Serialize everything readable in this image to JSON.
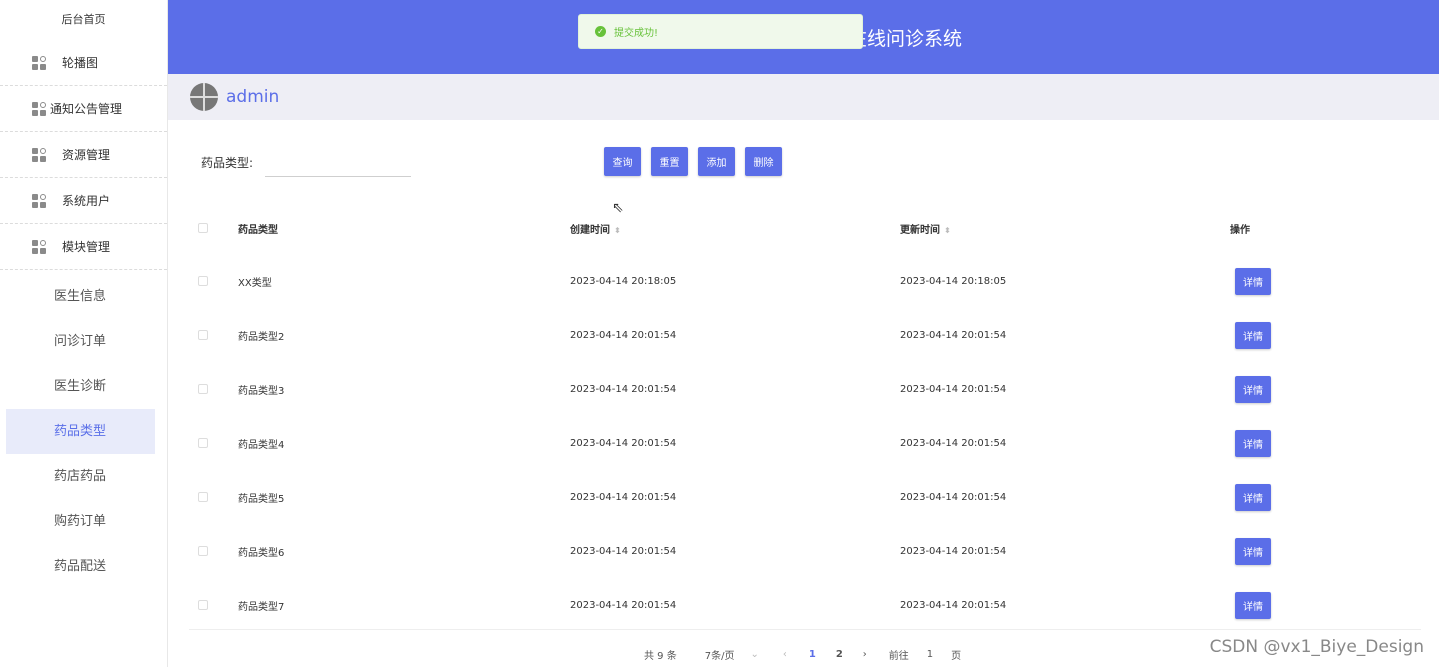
{
  "sidebar": {
    "home": "后台首页",
    "groups": [
      "轮播图",
      "通知公告管理",
      "资源管理",
      "系统用户",
      "模块管理"
    ],
    "subitems": [
      "医生信息",
      "问诊订单",
      "医生诊断",
      "药品类型",
      "药店药品",
      "购药订单",
      "药品配送"
    ],
    "active": "药品类型"
  },
  "header": {
    "title": "在线问诊系统"
  },
  "toast": {
    "message": "提交成功!"
  },
  "user": {
    "name": "admin"
  },
  "filter": {
    "label": "药品类型:",
    "value": ""
  },
  "buttons": {
    "search": "查询",
    "reset": "重置",
    "add": "添加",
    "delete": "删除"
  },
  "table": {
    "headers": [
      "药品类型",
      "创建时间",
      "更新时间",
      "操作"
    ],
    "rows": [
      {
        "name": "XX类型",
        "created": "2023-04-14 20:18:05",
        "updated": "2023-04-14 20:18:05",
        "op": "详情"
      },
      {
        "name": "药品类型2",
        "created": "2023-04-14 20:01:54",
        "updated": "2023-04-14 20:01:54",
        "op": "详情"
      },
      {
        "name": "药品类型3",
        "created": "2023-04-14 20:01:54",
        "updated": "2023-04-14 20:01:54",
        "op": "详情"
      },
      {
        "name": "药品类型4",
        "created": "2023-04-14 20:01:54",
        "updated": "2023-04-14 20:01:54",
        "op": "详情"
      },
      {
        "name": "药品类型5",
        "created": "2023-04-14 20:01:54",
        "updated": "2023-04-14 20:01:54",
        "op": "详情"
      },
      {
        "name": "药品类型6",
        "created": "2023-04-14 20:01:54",
        "updated": "2023-04-14 20:01:54",
        "op": "详情"
      },
      {
        "name": "药品类型7",
        "created": "2023-04-14 20:01:54",
        "updated": "2023-04-14 20:01:54",
        "op": "详情"
      }
    ]
  },
  "pagination": {
    "total": "共 9 条",
    "page_size": "7条/页",
    "pages": [
      "1",
      "2"
    ],
    "current": "1",
    "goto_prefix": "前往",
    "goto_value": "1",
    "goto_suffix": "页"
  },
  "watermark": "CSDN @vx1_Biye_Design",
  "colors": {
    "primary": "#5b6ee8",
    "success": "#67c23a"
  }
}
